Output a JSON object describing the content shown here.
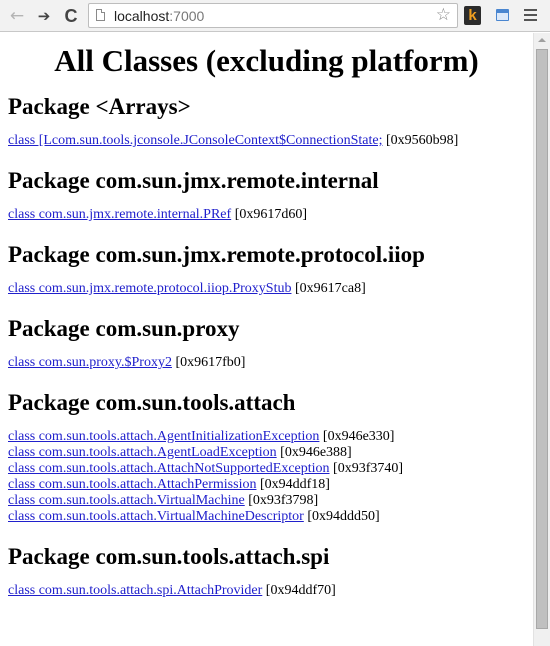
{
  "browser": {
    "back_icon": "←",
    "forward_icon": "➔",
    "reload_icon": "C",
    "url_host": "localhost",
    "url_port": ":7000",
    "bookmark_icon": "☆",
    "extension_k_label": "k"
  },
  "page": {
    "title": "All Classes (excluding platform)",
    "packages": [
      {
        "heading": "Package <Arrays>",
        "classes": [
          {
            "name": "class [Lcom.sun.tools.jconsole.JConsoleContext$ConnectionState;",
            "address": "[0x9560b98]"
          }
        ]
      },
      {
        "heading": "Package com.sun.jmx.remote.internal",
        "classes": [
          {
            "name": "class com.sun.jmx.remote.internal.PRef",
            "address": "[0x9617d60]"
          }
        ]
      },
      {
        "heading": "Package com.sun.jmx.remote.protocol.iiop",
        "classes": [
          {
            "name": "class com.sun.jmx.remote.protocol.iiop.ProxyStub",
            "address": "[0x9617ca8]"
          }
        ]
      },
      {
        "heading": "Package com.sun.proxy",
        "classes": [
          {
            "name": "class com.sun.proxy.$Proxy2",
            "address": "[0x9617fb0]"
          }
        ]
      },
      {
        "heading": "Package com.sun.tools.attach",
        "classes": [
          {
            "name": "class com.sun.tools.attach.AgentInitializationException",
            "address": "[0x946e330]"
          },
          {
            "name": "class com.sun.tools.attach.AgentLoadException",
            "address": "[0x946e388]"
          },
          {
            "name": "class com.sun.tools.attach.AttachNotSupportedException",
            "address": "[0x93f3740]"
          },
          {
            "name": "class com.sun.tools.attach.AttachPermission",
            "address": "[0x94ddf18]"
          },
          {
            "name": "class com.sun.tools.attach.VirtualMachine",
            "address": "[0x93f3798]"
          },
          {
            "name": "class com.sun.tools.attach.VirtualMachineDescriptor",
            "address": "[0x94ddd50]"
          }
        ]
      },
      {
        "heading": "Package com.sun.tools.attach.spi",
        "classes": [
          {
            "name": "class com.sun.tools.attach.spi.AttachProvider",
            "address": "[0x94ddf70]"
          }
        ]
      }
    ]
  }
}
